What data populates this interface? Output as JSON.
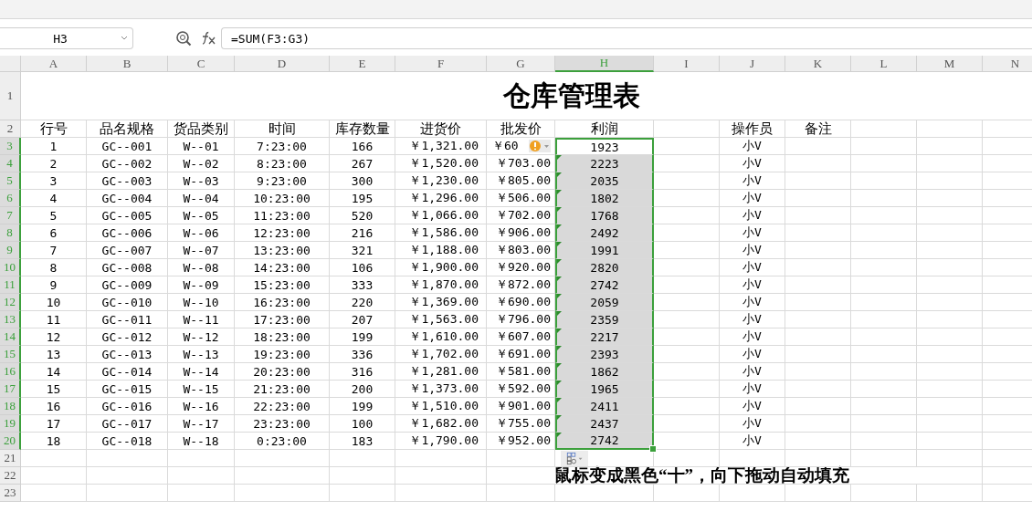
{
  "formula_bar": {
    "name_box": "H3",
    "formula": "=SUM(F3:G3)"
  },
  "sheet": {
    "columns": [
      {
        "label": "A",
        "selected": false
      },
      {
        "label": "B",
        "selected": false
      },
      {
        "label": "C",
        "selected": false
      },
      {
        "label": "D",
        "selected": false
      },
      {
        "label": "E",
        "selected": false
      },
      {
        "label": "F",
        "selected": false
      },
      {
        "label": "G",
        "selected": false
      },
      {
        "label": "H",
        "selected": true
      },
      {
        "label": "I",
        "selected": false
      },
      {
        "label": "J",
        "selected": false
      },
      {
        "label": "K",
        "selected": false
      },
      {
        "label": "L",
        "selected": false
      },
      {
        "label": "M",
        "selected": false
      },
      {
        "label": "N",
        "selected": false
      }
    ],
    "title_row": {
      "label": "1",
      "title": "仓库管理表"
    },
    "header_row": {
      "label": "2",
      "cells": [
        "行号",
        "品名规格",
        "货品类别",
        "时间",
        "库存数量",
        "进货价",
        "批发价",
        "利润"
      ],
      "operator": "操作员",
      "remark": "备注"
    },
    "rows": [
      {
        "label": "3",
        "selected": true,
        "warning": true,
        "values": [
          "1",
          "GC--001",
          "W--01",
          "7:23:00",
          "166",
          "￥1,321.00",
          "￥60"
        ],
        "profit": {
          "text": "1923",
          "active": true,
          "flagged": false
        },
        "operator": "小V"
      },
      {
        "label": "4",
        "selected": true,
        "warning": false,
        "values": [
          "2",
          "GC--002",
          "W--02",
          "8:23:00",
          "267",
          "￥1,520.00",
          "￥703.00"
        ],
        "profit": {
          "text": "2223",
          "active": false,
          "flagged": true
        },
        "operator": "小V"
      },
      {
        "label": "5",
        "selected": true,
        "warning": false,
        "values": [
          "3",
          "GC--003",
          "W--03",
          "9:23:00",
          "300",
          "￥1,230.00",
          "￥805.00"
        ],
        "profit": {
          "text": "2035",
          "active": false,
          "flagged": true
        },
        "operator": "小V"
      },
      {
        "label": "6",
        "selected": true,
        "warning": false,
        "values": [
          "4",
          "GC--004",
          "W--04",
          "10:23:00",
          "195",
          "￥1,296.00",
          "￥506.00"
        ],
        "profit": {
          "text": "1802",
          "active": false,
          "flagged": true
        },
        "operator": "小V"
      },
      {
        "label": "7",
        "selected": true,
        "warning": false,
        "values": [
          "5",
          "GC--005",
          "W--05",
          "11:23:00",
          "520",
          "￥1,066.00",
          "￥702.00"
        ],
        "profit": {
          "text": "1768",
          "active": false,
          "flagged": true
        },
        "operator": "小V"
      },
      {
        "label": "8",
        "selected": true,
        "warning": false,
        "values": [
          "6",
          "GC--006",
          "W--06",
          "12:23:00",
          "216",
          "￥1,586.00",
          "￥906.00"
        ],
        "profit": {
          "text": "2492",
          "active": false,
          "flagged": true
        },
        "operator": "小V"
      },
      {
        "label": "9",
        "selected": true,
        "warning": false,
        "values": [
          "7",
          "GC--007",
          "W--07",
          "13:23:00",
          "321",
          "￥1,188.00",
          "￥803.00"
        ],
        "profit": {
          "text": "1991",
          "active": false,
          "flagged": true
        },
        "operator": "小V"
      },
      {
        "label": "10",
        "selected": true,
        "warning": false,
        "values": [
          "8",
          "GC--008",
          "W--08",
          "14:23:00",
          "106",
          "￥1,900.00",
          "￥920.00"
        ],
        "profit": {
          "text": "2820",
          "active": false,
          "flagged": true
        },
        "operator": "小V"
      },
      {
        "label": "11",
        "selected": true,
        "warning": false,
        "values": [
          "9",
          "GC--009",
          "W--09",
          "15:23:00",
          "333",
          "￥1,870.00",
          "￥872.00"
        ],
        "profit": {
          "text": "2742",
          "active": false,
          "flagged": true
        },
        "operator": "小V"
      },
      {
        "label": "12",
        "selected": true,
        "warning": false,
        "values": [
          "10",
          "GC--010",
          "W--10",
          "16:23:00",
          "220",
          "￥1,369.00",
          "￥690.00"
        ],
        "profit": {
          "text": "2059",
          "active": false,
          "flagged": true
        },
        "operator": "小V"
      },
      {
        "label": "13",
        "selected": true,
        "warning": false,
        "values": [
          "11",
          "GC--011",
          "W--11",
          "17:23:00",
          "207",
          "￥1,563.00",
          "￥796.00"
        ],
        "profit": {
          "text": "2359",
          "active": false,
          "flagged": true
        },
        "operator": "小V"
      },
      {
        "label": "14",
        "selected": true,
        "warning": false,
        "values": [
          "12",
          "GC--012",
          "W--12",
          "18:23:00",
          "199",
          "￥1,610.00",
          "￥607.00"
        ],
        "profit": {
          "text": "2217",
          "active": false,
          "flagged": true
        },
        "operator": "小V"
      },
      {
        "label": "15",
        "selected": true,
        "warning": false,
        "values": [
          "13",
          "GC--013",
          "W--13",
          "19:23:00",
          "336",
          "￥1,702.00",
          "￥691.00"
        ],
        "profit": {
          "text": "2393",
          "active": false,
          "flagged": true
        },
        "operator": "小V"
      },
      {
        "label": "16",
        "selected": true,
        "warning": false,
        "values": [
          "14",
          "GC--014",
          "W--14",
          "20:23:00",
          "316",
          "￥1,281.00",
          "￥581.00"
        ],
        "profit": {
          "text": "1862",
          "active": false,
          "flagged": true
        },
        "operator": "小V"
      },
      {
        "label": "17",
        "selected": true,
        "warning": false,
        "values": [
          "15",
          "GC--015",
          "W--15",
          "21:23:00",
          "200",
          "￥1,373.00",
          "￥592.00"
        ],
        "profit": {
          "text": "1965",
          "active": false,
          "flagged": true
        },
        "operator": "小V"
      },
      {
        "label": "18",
        "selected": true,
        "warning": false,
        "values": [
          "16",
          "GC--016",
          "W--16",
          "22:23:00",
          "199",
          "￥1,510.00",
          "￥901.00"
        ],
        "profit": {
          "text": "2411",
          "active": false,
          "flagged": true
        },
        "operator": "小V"
      },
      {
        "label": "19",
        "selected": true,
        "warning": false,
        "values": [
          "17",
          "GC--017",
          "W--17",
          "23:23:00",
          "100",
          "￥1,682.00",
          "￥755.00"
        ],
        "profit": {
          "text": "2437",
          "active": false,
          "flagged": true
        },
        "operator": "小V"
      },
      {
        "label": "20",
        "selected": true,
        "warning": false,
        "values": [
          "18",
          "GC--018",
          "W--18",
          "0:23:00",
          "183",
          "￥1,790.00",
          "￥952.00"
        ],
        "profit": {
          "text": "2742",
          "active": false,
          "flagged": true
        },
        "operator": "小V"
      }
    ],
    "empty_rows": [
      {
        "label": "21"
      },
      {
        "label": "22",
        "note": "鼠标变成黑色“十”，向下拖动自动填充"
      },
      {
        "label": "23"
      }
    ]
  }
}
